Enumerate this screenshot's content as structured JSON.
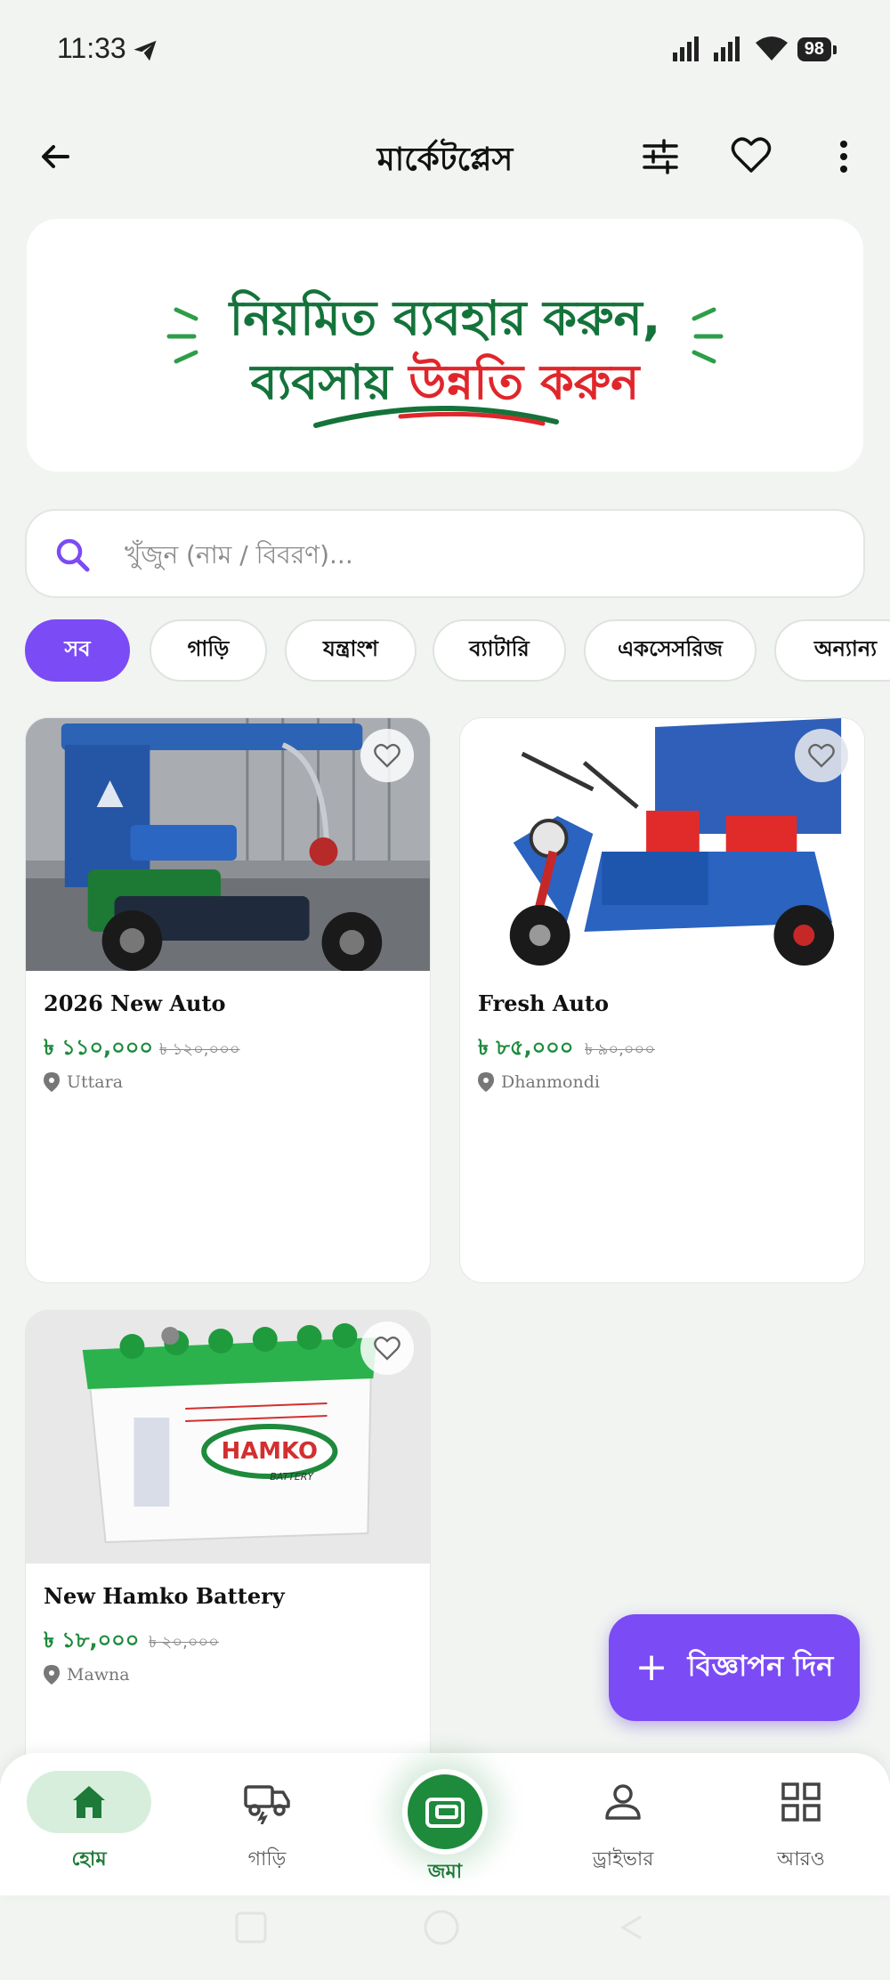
{
  "status": {
    "time": "11:33",
    "battery": "98"
  },
  "appbar": {
    "title": "মার্কেটপ্লেস"
  },
  "banner": {
    "line1": "নিয়মিত ব্যবহার করুন,",
    "line2_part1": "ব্যবসায় ",
    "line2_part2": "উন্নতি করুন",
    "accent_green": "#14733a",
    "accent_red": "#e0262b"
  },
  "search": {
    "placeholder": "খুঁজুন (নাম / বিবরণ)..."
  },
  "categories": [
    "সব",
    "গাড়ি",
    "যন্ত্রাংশ",
    "ব্যাটারি",
    "একসেসরিজ",
    "অন্যান্য"
  ],
  "listings": [
    {
      "title": "2026 New Auto",
      "price": "৳ ১১০,০০০",
      "old_price": "৳ ১২০,০০০",
      "location": "Uttara"
    },
    {
      "title": "Fresh Auto",
      "price": "৳ ৮৫,০০০",
      "old_price": "৳ ৯০,০০০",
      "location": "Dhanmondi"
    },
    {
      "title": "New Hamko Battery",
      "price": "৳ ১৮,০০০",
      "old_price": "৳ ২০,০০০",
      "location": "Mawna"
    }
  ],
  "battery_brand": {
    "name": "HAMKO",
    "sub": "BATTERY"
  },
  "fab": {
    "label": "বিজ্ঞাপন দিন"
  },
  "nav": {
    "home": "হোম",
    "vehicle": "গাড়ি",
    "deposit": "জমা",
    "driver": "ড্রাইভার",
    "more": "আরও"
  },
  "colors": {
    "primary": "#7b4bf5",
    "green": "#1e8a3c",
    "bg": "#f1f4f1"
  }
}
